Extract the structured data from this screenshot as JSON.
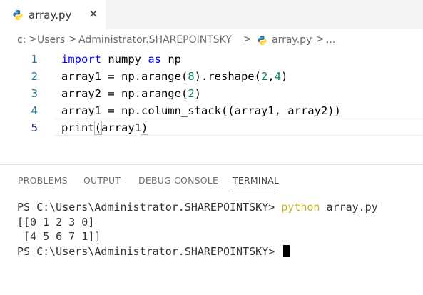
{
  "tab": {
    "filename": "array.py",
    "close_glyph": "✕",
    "icon": "python-icon"
  },
  "breadcrumb": {
    "drive": "c:",
    "users": "Users",
    "admin": "Administrator.SHAREPOINTSKY",
    "file": "array.py",
    "more": "...",
    "separator": ">"
  },
  "editor": {
    "active_line": 5,
    "lines": [
      {
        "number": "1"
      },
      {
        "number": "2"
      },
      {
        "number": "3"
      },
      {
        "number": "4"
      },
      {
        "number": "5"
      }
    ],
    "tokens": {
      "l1_kw1": "import",
      "l1_mod": " numpy ",
      "l1_kw2": "as",
      "l1_alias": " np",
      "l2_a": "array1 = np.arange(",
      "l2_n1": "8",
      "l2_b": ").reshape(",
      "l2_n2": "2",
      "l2_c": ",",
      "l2_n3": "4",
      "l2_d": ")",
      "l3_a": "array2 = np.arange(",
      "l3_n1": "2",
      "l3_b": ")",
      "l4": "array1 = np.column_stack((array1, array2))",
      "l5_a": "print",
      "l5_open": "(",
      "l5_b": "array1",
      "l5_close": ")"
    }
  },
  "panel": {
    "tabs": [
      "PROBLEMS",
      "OUTPUT",
      "DEBUG CONSOLE",
      "TERMINAL"
    ],
    "active_tab": "TERMINAL"
  },
  "terminal": {
    "prompt1": "PS C:\\Users\\Administrator.SHAREPOINTSKY> ",
    "command": "python",
    "command_arg": " array.py",
    "output1": "[[0 1 2 3 0]",
    "output2": " [4 5 6 7 1]]",
    "prompt2": "PS C:\\Users\\Administrator.SHAREPOINTSKY> "
  },
  "colors": {
    "keyword": "#0000ff",
    "number": "#098658",
    "line_number": "#237893",
    "active_line_number": "#0b216f",
    "terminal_command": "#c5b22b",
    "python_blue": "#3572a5",
    "python_yellow": "#ffd43b"
  }
}
